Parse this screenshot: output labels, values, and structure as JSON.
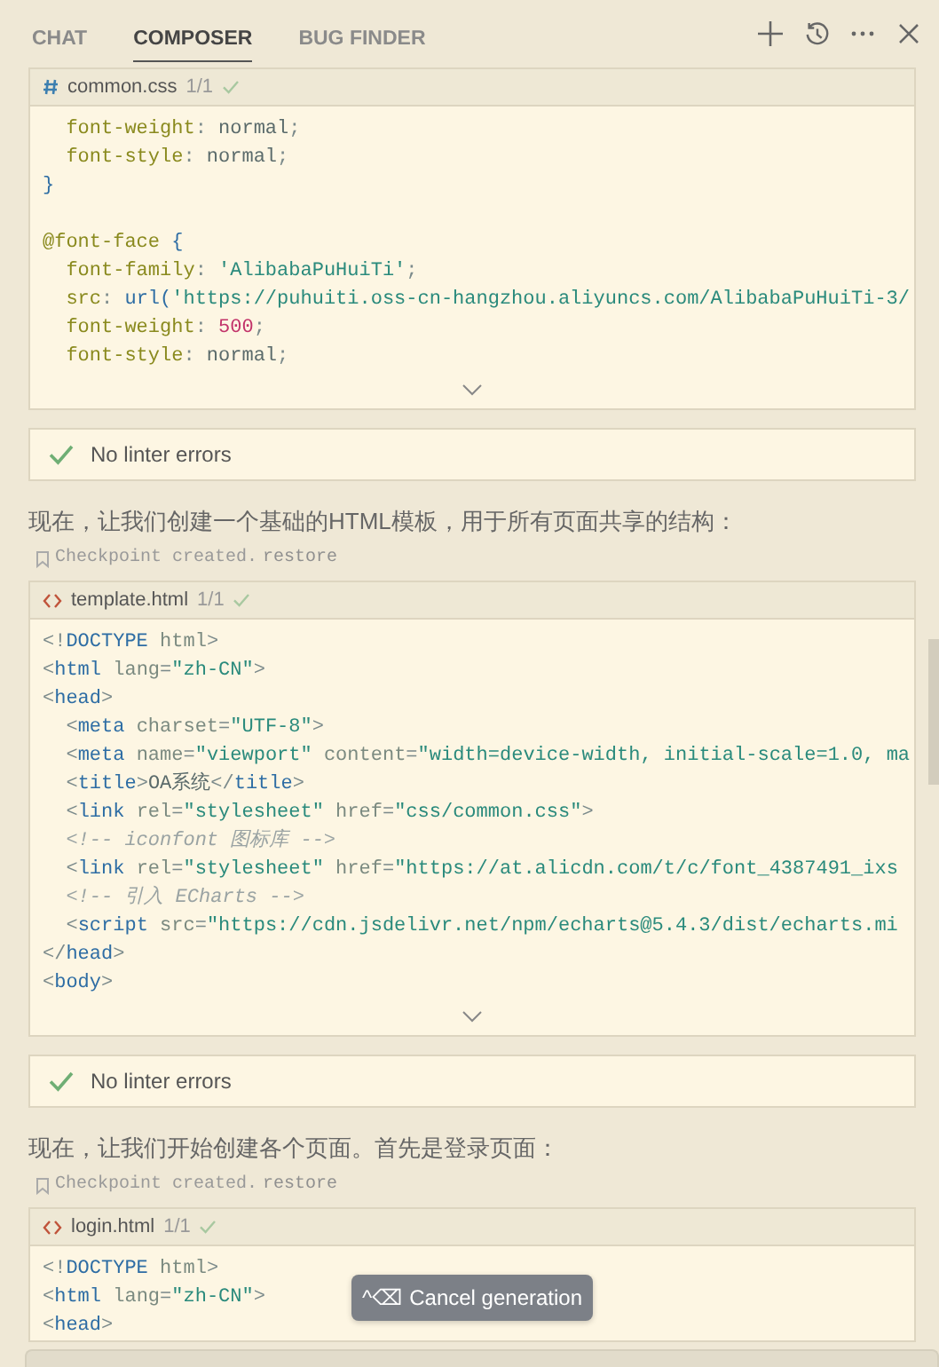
{
  "tabs": [
    {
      "label": "CHAT",
      "selected": false
    },
    {
      "label": "COMPOSER",
      "selected": true
    },
    {
      "label": "BUG FINDER",
      "selected": false
    }
  ],
  "feed": [
    {
      "kind": "code",
      "truncated": true,
      "header": {
        "kind": "css",
        "file": "common.css",
        "counter": "1/1",
        "applied": true
      },
      "lines": [
        {
          "kind": "code",
          "tokens": [
            {
              "kind": "prop",
              "text": "  font-weight"
            },
            {
              "kind": "p",
              "text": ": "
            },
            {
              "kind": "val",
              "text": "normal"
            },
            {
              "kind": "p",
              "text": ";"
            }
          ]
        },
        {
          "kind": "code",
          "tokens": [
            {
              "kind": "prop",
              "text": "  font-style"
            },
            {
              "kind": "p",
              "text": ": "
            },
            {
              "kind": "val",
              "text": "normal"
            },
            {
              "kind": "p",
              "text": ";"
            }
          ]
        },
        {
          "kind": "code",
          "tokens": [
            {
              "kind": "tag",
              "text": "}"
            }
          ]
        },
        {
          "kind": "blank"
        },
        {
          "kind": "code",
          "tokens": [
            {
              "kind": "prop",
              "text": "@font-face"
            },
            {
              "kind": "tag",
              "text": " {"
            }
          ]
        },
        {
          "kind": "code",
          "tokens": [
            {
              "kind": "prop",
              "text": "  font-family"
            },
            {
              "kind": "p",
              "text": ": "
            },
            {
              "kind": "str",
              "text": "'AlibabaPuHuiTi'"
            },
            {
              "kind": "p",
              "text": ";"
            }
          ]
        },
        {
          "kind": "code",
          "tokens": [
            {
              "kind": "prop",
              "text": "  src"
            },
            {
              "kind": "p",
              "text": ": "
            },
            {
              "kind": "tag",
              "text": "url("
            },
            {
              "kind": "str",
              "text": "'https://puhuiti.oss-cn-hangzhou.aliyuncs.com/AlibabaPuHuiTi-3/"
            }
          ]
        },
        {
          "kind": "code",
          "tokens": [
            {
              "kind": "prop",
              "text": "  font-weight"
            },
            {
              "kind": "p",
              "text": ": "
            },
            {
              "kind": "num",
              "text": "500"
            },
            {
              "kind": "p",
              "text": ";"
            }
          ]
        },
        {
          "kind": "code",
          "tokens": [
            {
              "kind": "prop",
              "text": "  font-style"
            },
            {
              "kind": "p",
              "text": ": "
            },
            {
              "kind": "val",
              "text": "normal"
            },
            {
              "kind": "p",
              "text": ";"
            }
          ]
        }
      ]
    },
    {
      "kind": "lint",
      "text": "No linter errors"
    },
    {
      "kind": "message",
      "text": "现在，让我们创建一个基础的HTML模板，用于所有页面共享的结构："
    },
    {
      "kind": "checkpoint",
      "text": "Checkpoint created.",
      "link": "restore"
    },
    {
      "kind": "code",
      "truncated": true,
      "header": {
        "kind": "html",
        "file": "template.html",
        "counter": "1/1",
        "applied": true
      },
      "lines": [
        {
          "kind": "code",
          "tokens": [
            {
              "kind": "p",
              "text": "<!"
            },
            {
              "kind": "tag",
              "text": "DOCTYPE"
            },
            {
              "kind": "attr",
              "text": " html"
            },
            {
              "kind": "p",
              "text": ">"
            }
          ]
        },
        {
          "kind": "code",
          "tokens": [
            {
              "kind": "p",
              "text": "<"
            },
            {
              "kind": "tag",
              "text": "html"
            },
            {
              "kind": "attr",
              "text": " lang"
            },
            {
              "kind": "p",
              "text": "="
            },
            {
              "kind": "str",
              "text": "\"zh-CN\""
            },
            {
              "kind": "p",
              "text": ">"
            }
          ]
        },
        {
          "kind": "code",
          "tokens": [
            {
              "kind": "p",
              "text": "<"
            },
            {
              "kind": "tag",
              "text": "head"
            },
            {
              "kind": "p",
              "text": ">"
            }
          ]
        },
        {
          "kind": "code",
          "tokens": [
            {
              "kind": "p",
              "text": "  <"
            },
            {
              "kind": "tag",
              "text": "meta"
            },
            {
              "kind": "attr",
              "text": " charset"
            },
            {
              "kind": "p",
              "text": "="
            },
            {
              "kind": "str",
              "text": "\"UTF-8\""
            },
            {
              "kind": "p",
              "text": ">"
            }
          ]
        },
        {
          "kind": "code",
          "tokens": [
            {
              "kind": "p",
              "text": "  <"
            },
            {
              "kind": "tag",
              "text": "meta"
            },
            {
              "kind": "attr",
              "text": " name"
            },
            {
              "kind": "p",
              "text": "="
            },
            {
              "kind": "str",
              "text": "\"viewport\""
            },
            {
              "kind": "attr",
              "text": " content"
            },
            {
              "kind": "p",
              "text": "="
            },
            {
              "kind": "str",
              "text": "\"width=device-width, initial-scale=1.0, ma"
            }
          ]
        },
        {
          "kind": "code",
          "tokens": [
            {
              "kind": "p",
              "text": "  <"
            },
            {
              "kind": "tag",
              "text": "title"
            },
            {
              "kind": "p",
              "text": ">"
            },
            {
              "kind": "val",
              "text": "OA系统"
            },
            {
              "kind": "p",
              "text": "</"
            },
            {
              "kind": "tag",
              "text": "title"
            },
            {
              "kind": "p",
              "text": ">"
            }
          ]
        },
        {
          "kind": "code",
          "tokens": [
            {
              "kind": "p",
              "text": "  <"
            },
            {
              "kind": "tag",
              "text": "link"
            },
            {
              "kind": "attr",
              "text": " rel"
            },
            {
              "kind": "p",
              "text": "="
            },
            {
              "kind": "str",
              "text": "\"stylesheet\""
            },
            {
              "kind": "attr",
              "text": " href"
            },
            {
              "kind": "p",
              "text": "="
            },
            {
              "kind": "str",
              "text": "\"css/common.css\""
            },
            {
              "kind": "p",
              "text": ">"
            }
          ]
        },
        {
          "kind": "code",
          "tokens": [
            {
              "kind": "com",
              "text": "  <!-- iconfont 图标库 -->"
            }
          ]
        },
        {
          "kind": "code",
          "tokens": [
            {
              "kind": "p",
              "text": "  <"
            },
            {
              "kind": "tag",
              "text": "link"
            },
            {
              "kind": "attr",
              "text": " rel"
            },
            {
              "kind": "p",
              "text": "="
            },
            {
              "kind": "str",
              "text": "\"stylesheet\""
            },
            {
              "kind": "attr",
              "text": " href"
            },
            {
              "kind": "p",
              "text": "="
            },
            {
              "kind": "str",
              "text": "\"https://at.alicdn.com/t/c/font_4387491_ixs"
            }
          ]
        },
        {
          "kind": "code",
          "tokens": [
            {
              "kind": "com",
              "text": "  <!-- 引入 ECharts -->"
            }
          ]
        },
        {
          "kind": "code",
          "tokens": [
            {
              "kind": "p",
              "text": "  <"
            },
            {
              "kind": "tag",
              "text": "script"
            },
            {
              "kind": "attr",
              "text": " src"
            },
            {
              "kind": "p",
              "text": "="
            },
            {
              "kind": "str",
              "text": "\"https://cdn.jsdelivr.net/npm/echarts@5.4.3/dist/echarts.mi"
            }
          ]
        },
        {
          "kind": "code",
          "tokens": [
            {
              "kind": "p",
              "text": "</"
            },
            {
              "kind": "tag",
              "text": "head"
            },
            {
              "kind": "p",
              "text": ">"
            }
          ]
        },
        {
          "kind": "code",
          "tokens": [
            {
              "kind": "p",
              "text": "<"
            },
            {
              "kind": "tag",
              "text": "body"
            },
            {
              "kind": "p",
              "text": ">"
            }
          ]
        }
      ]
    },
    {
      "kind": "lint",
      "text": "No linter errors"
    },
    {
      "kind": "message",
      "text": "现在，让我们开始创建各个页面。首先是登录页面："
    },
    {
      "kind": "checkpoint",
      "text": "Checkpoint created.",
      "link": "restore"
    },
    {
      "kind": "code",
      "header": {
        "kind": "html",
        "file": "login.html",
        "counter": "1/1",
        "applied": true
      },
      "lines": [
        {
          "kind": "code",
          "tokens": [
            {
              "kind": "p",
              "text": "<!"
            },
            {
              "kind": "tag",
              "text": "DOCTYPE"
            },
            {
              "kind": "attr",
              "text": " html"
            },
            {
              "kind": "p",
              "text": ">"
            }
          ]
        },
        {
          "kind": "code",
          "tokens": [
            {
              "kind": "p",
              "text": "<"
            },
            {
              "kind": "tag",
              "text": "html"
            },
            {
              "kind": "attr",
              "text": " lang"
            },
            {
              "kind": "p",
              "text": "="
            },
            {
              "kind": "str",
              "text": "\"zh-CN\""
            },
            {
              "kind": "p",
              "text": ">"
            }
          ]
        },
        {
          "kind": "code",
          "tokens": [
            {
              "kind": "p",
              "text": "<"
            },
            {
              "kind": "tag",
              "text": "head"
            },
            {
              "kind": "p",
              "text": ">"
            }
          ]
        }
      ]
    }
  ],
  "tooltip": {
    "shortcut": "^⌫",
    "label": "Cancel generation"
  }
}
